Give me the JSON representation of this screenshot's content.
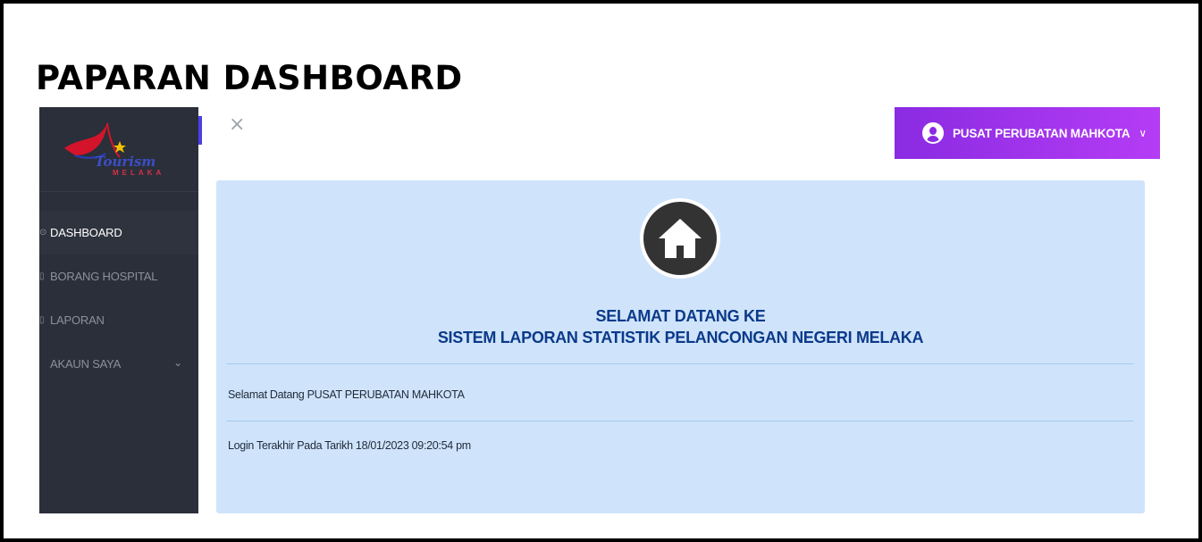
{
  "page_heading": "PAPARAN DASHBOARD",
  "logo": {
    "text": "Tourism",
    "sub": "MELAKA"
  },
  "sidebar": {
    "items": [
      {
        "label": "DASHBOARD",
        "active": true
      },
      {
        "label": "BORANG HOSPITAL",
        "active": false
      },
      {
        "label": "LAPORAN",
        "active": false
      },
      {
        "label": "AKAUN SAYA",
        "active": false,
        "has_submenu": true
      }
    ]
  },
  "header": {
    "close_symbol": "×",
    "user_name": "PUSAT PERUBATAN MAHKOTA",
    "user_chevron": "∨"
  },
  "main": {
    "title_line1": "SELAMAT DATANG KE",
    "title_line2": "SISTEM LAPORAN STATISTIK PELANCONGAN NEGERI MELAKA",
    "welcome_text": "Selamat Datang PUSAT PERUBATAN MAHKOTA",
    "last_login_text": "Login Terakhir Pada Tarikh 18/01/2023 09:20:54 pm"
  },
  "colors": {
    "sidebar_bg": "#2b2f3a",
    "accent_gradient_start": "#8a2be2",
    "accent_gradient_end": "#b53cf5",
    "card_bg": "#cfe4fb",
    "title_color": "#0b3a8a"
  }
}
